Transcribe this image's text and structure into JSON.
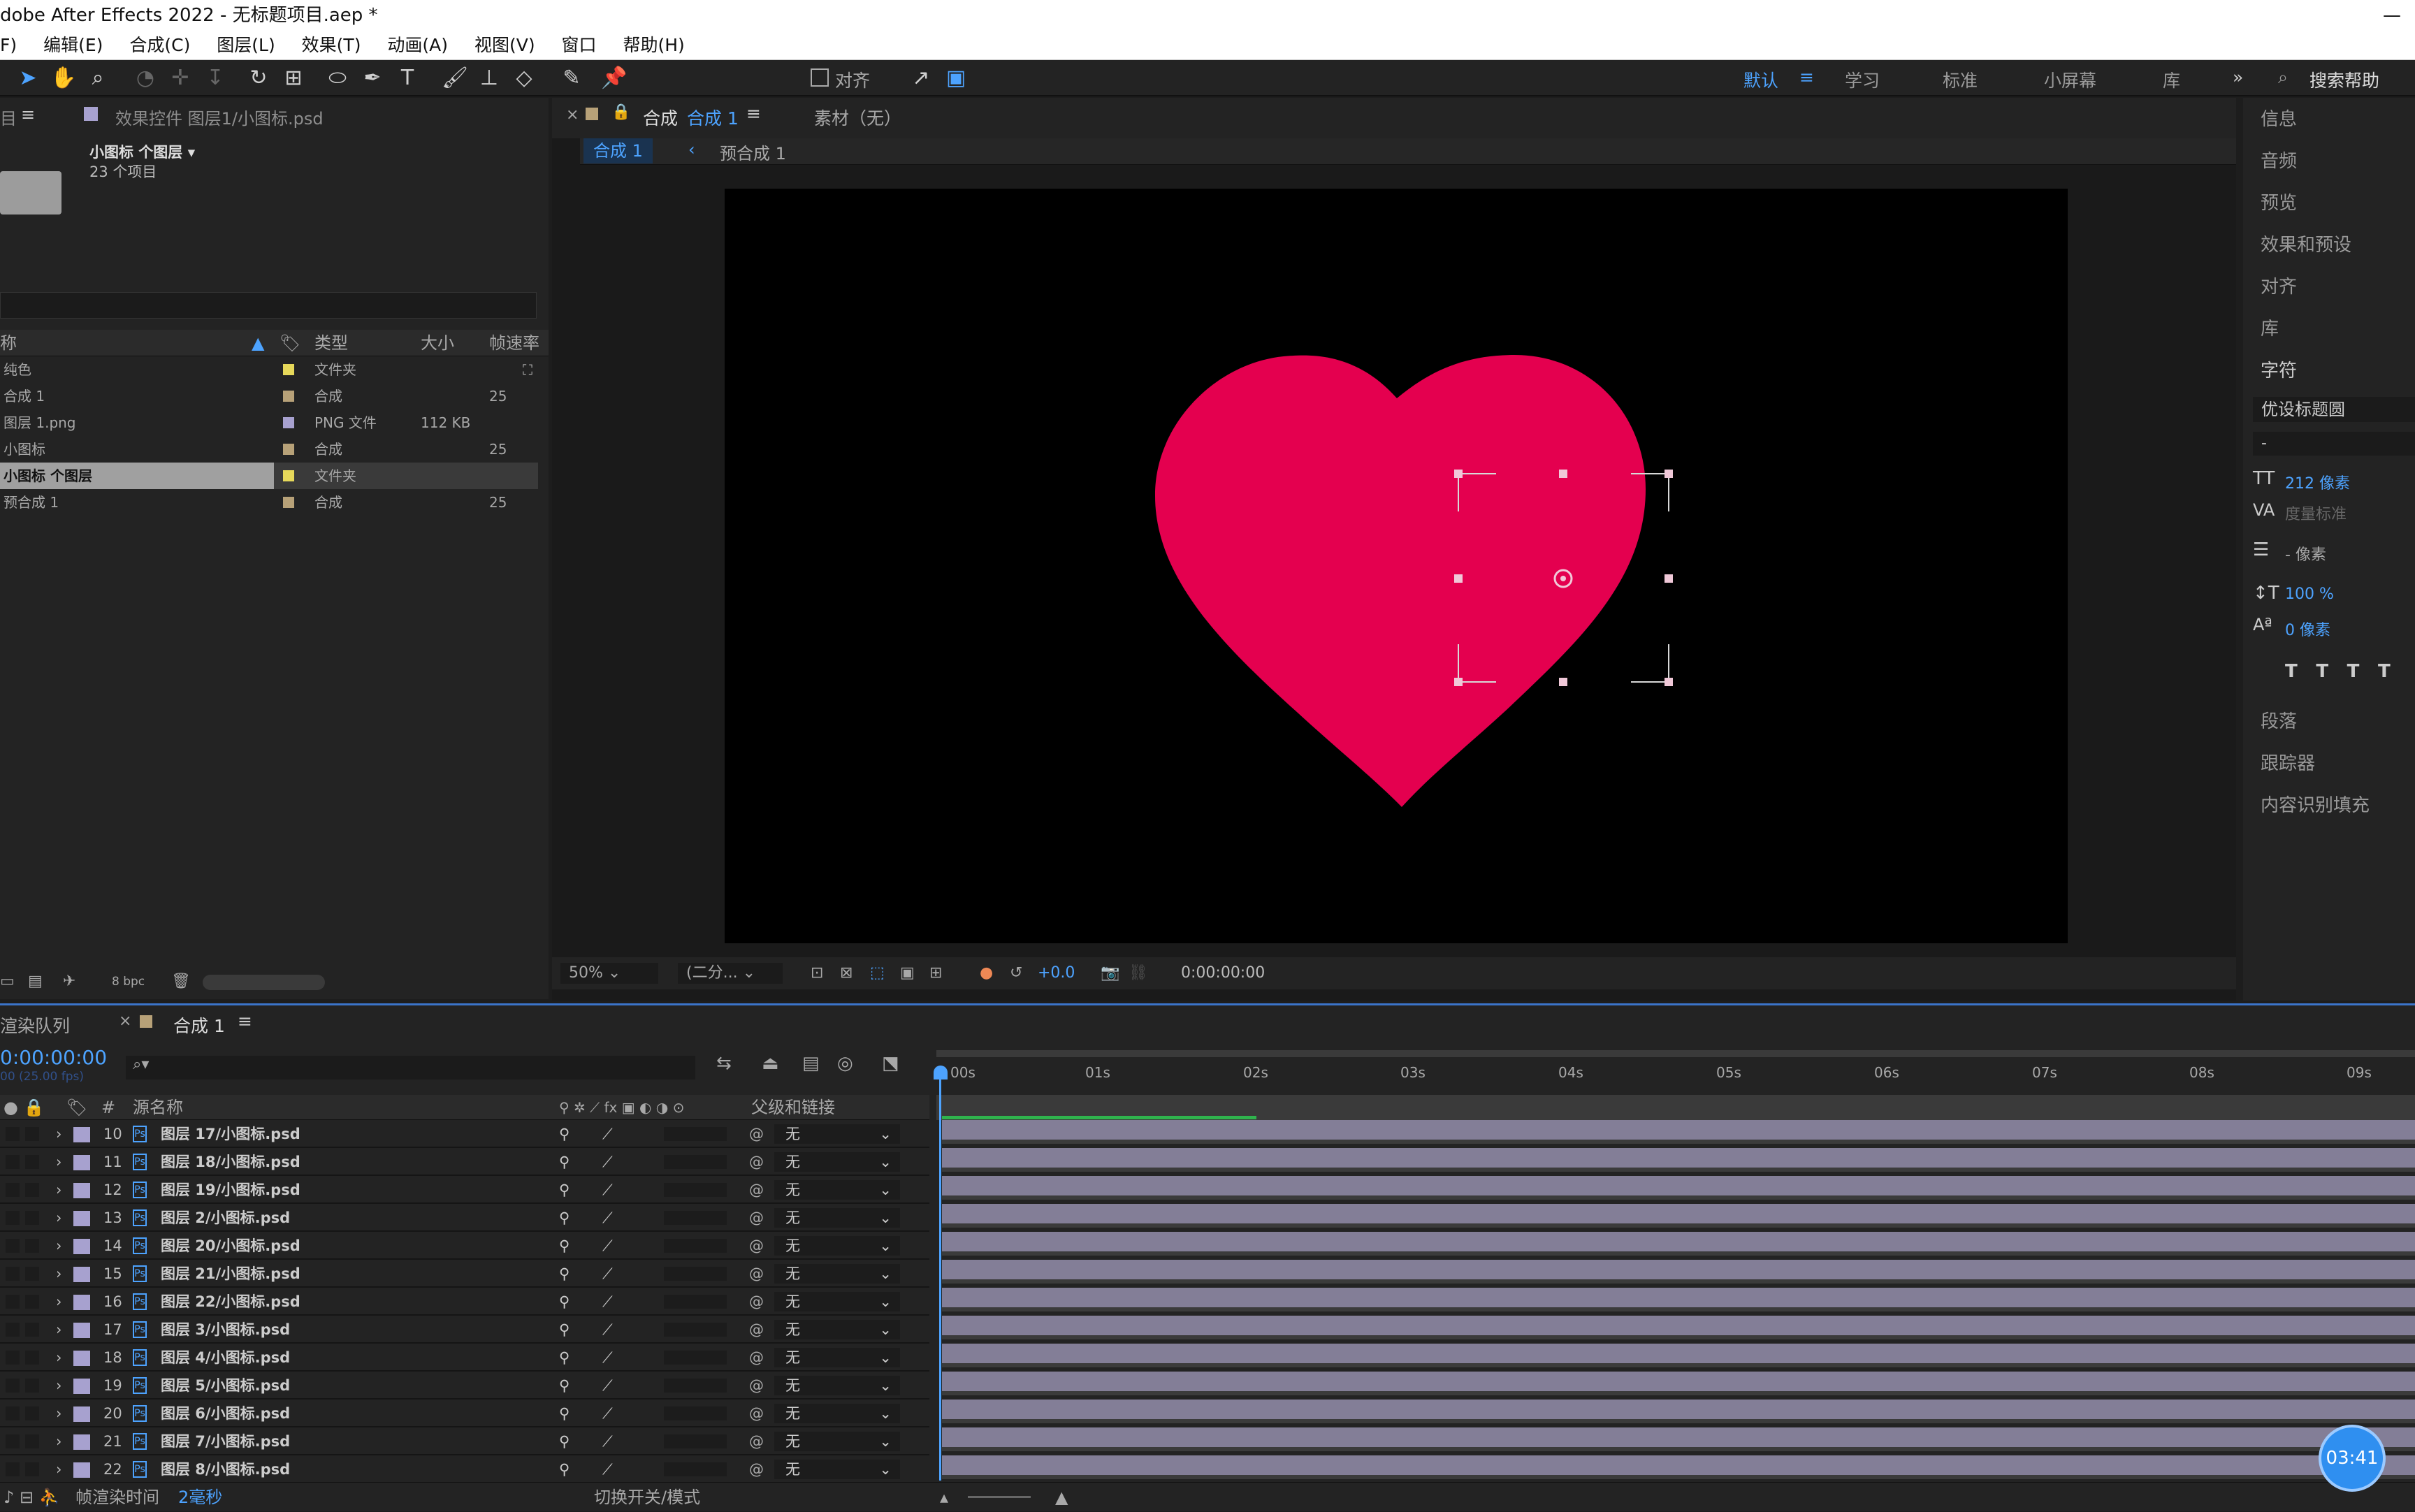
{
  "window": {
    "title": "dobe After Effects 2022 - 无标题项目.aep *",
    "min": "—"
  },
  "menu": [
    "F)",
    "编辑(E)",
    "合成(C)",
    "图层(L)",
    "效果(T)",
    "动画(A)",
    "视图(V)",
    "窗口",
    "帮助(H)"
  ],
  "toolbar": {
    "align_label": "对齐",
    "workspaces": [
      "默认",
      "学习",
      "标准",
      "小屏幕",
      "库"
    ],
    "more": "»",
    "search": "搜索帮助"
  },
  "project": {
    "tab1": "目",
    "tab2": "效果控件 图层1/小图标.psd",
    "selected_name": "小图标 个图层 ▾",
    "selected_count": "23 个项目",
    "columns": {
      "name": "称",
      "type": "类型",
      "size": "大小",
      "fps": "帧速率"
    },
    "items": [
      {
        "name": "纯色",
        "color": "#e6d85a",
        "type": "文件夹",
        "size": "",
        "fps": ""
      },
      {
        "name": "合成 1",
        "color": "#b7a178",
        "type": "合成",
        "size": "",
        "fps": "25"
      },
      {
        "name": "图层 1.png",
        "color": "#a7a1cf",
        "type": "PNG 文件",
        "size": "112 KB",
        "fps": ""
      },
      {
        "name": "小图标",
        "color": "#b7a178",
        "type": "合成",
        "size": "",
        "fps": "25"
      },
      {
        "name": "小图标 个图层",
        "color": "#e6d85a",
        "type": "文件夹",
        "size": "",
        "fps": ""
      },
      {
        "name": "预合成 1",
        "color": "#b7a178",
        "type": "合成",
        "size": "",
        "fps": "25"
      }
    ],
    "bpc": "8 bpc"
  },
  "comp": {
    "tab_prefix": "合成",
    "tab_name": "合成 1",
    "footage_tab": "素材（无）",
    "crumb1": "合成 1",
    "crumb2": "预合成 1",
    "zoom": "50%",
    "resolution": "(二分...",
    "exposure": "+0.0",
    "timecode": "0:00:00:00",
    "heart_color": "#e4004f"
  },
  "right_panel": {
    "items": [
      "信息",
      "音频",
      "预览",
      "效果和预设",
      "对齐",
      "库",
      "字符"
    ],
    "font": "优设标题圆",
    "style": "-",
    "font_size": "212 像素",
    "tracking_label": "度量标准",
    "leading": "- 像素",
    "v_scale": "100 %",
    "baseline": "0 像素",
    "items2": [
      "段落",
      "跟踪器",
      "内容识别填充"
    ]
  },
  "timeline": {
    "tab_render": "渲染队列",
    "tab_comp": "合成 1",
    "timecode": "0:00:00:00",
    "fps": "00 (25.00 fps)",
    "col_source": "源名称",
    "col_parent": "父级和链接",
    "ruler": [
      "00s",
      "01s",
      "02s",
      "03s",
      "04s",
      "05s",
      "06s",
      "07s",
      "08s",
      "09s"
    ],
    "layers": [
      {
        "num": "10",
        "name": "图层 17/小图标.psd",
        "parent": "无"
      },
      {
        "num": "11",
        "name": "图层 18/小图标.psd",
        "parent": "无"
      },
      {
        "num": "12",
        "name": "图层 19/小图标.psd",
        "parent": "无"
      },
      {
        "num": "13",
        "name": "图层 2/小图标.psd",
        "parent": "无"
      },
      {
        "num": "14",
        "name": "图层 20/小图标.psd",
        "parent": "无"
      },
      {
        "num": "15",
        "name": "图层 21/小图标.psd",
        "parent": "无"
      },
      {
        "num": "16",
        "name": "图层 22/小图标.psd",
        "parent": "无"
      },
      {
        "num": "17",
        "name": "图层 3/小图标.psd",
        "parent": "无"
      },
      {
        "num": "18",
        "name": "图层 4/小图标.psd",
        "parent": "无"
      },
      {
        "num": "19",
        "name": "图层 5/小图标.psd",
        "parent": "无"
      },
      {
        "num": "20",
        "name": "图层 6/小图标.psd",
        "parent": "无"
      },
      {
        "num": "21",
        "name": "图层 7/小图标.psd",
        "parent": "无"
      },
      {
        "num": "22",
        "name": "图层 8/小图标.psd",
        "parent": "无"
      }
    ],
    "status_label": "帧渲染时间",
    "status_value": "2毫秒",
    "toggle": "切换开关/模式",
    "timer": "03:41"
  }
}
